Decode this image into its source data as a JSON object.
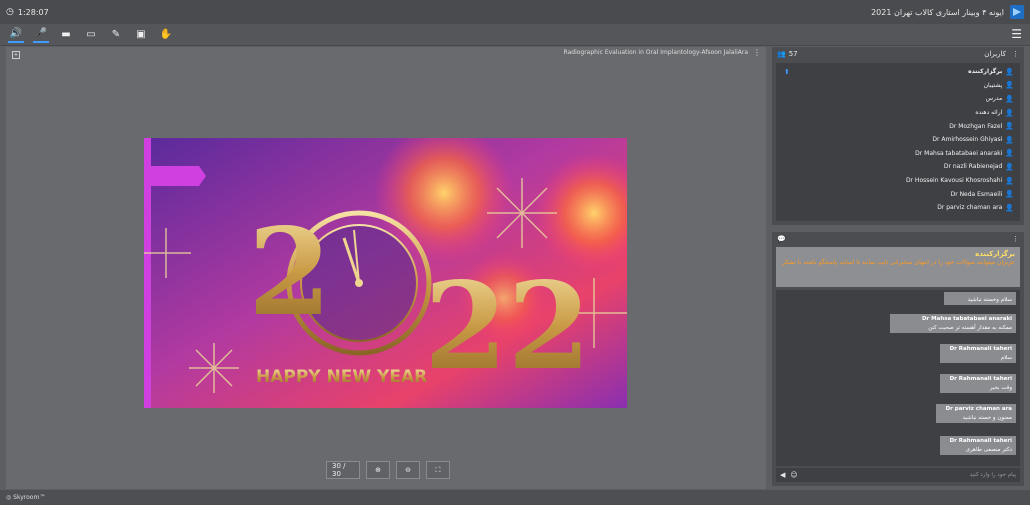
{
  "topbar": {
    "timer": "1:28:07",
    "title": "ایونه ۴ وبینار استاری کالاب تهران 2021"
  },
  "stage": {
    "title": "Radiographic Evaluation in Oral Implantology-Afsoon JalaliAra",
    "slide_text": "HAPPY NEW YEAR",
    "slide_digit_2": "2",
    "slide_digits_22": "22",
    "page_indicator": "30 / 30"
  },
  "status": {
    "brand": "Skyroom™"
  },
  "users": {
    "count": "57",
    "title": "کاربران",
    "items": [
      {
        "name": "برگزارکننده",
        "presenter": true
      },
      {
        "name": "پشتیبان"
      },
      {
        "name": "مدرس"
      },
      {
        "name": "ارائه دهنده"
      },
      {
        "name": "Dr Mozhgan Fazel"
      },
      {
        "name": "Dr Amirhossein Ghiyasi"
      },
      {
        "name": "Dr Mahsa tabatabaei anaraki"
      },
      {
        "name": "Dr nazli Rabienejad"
      },
      {
        "name": "Dr Hossein Kavousi Khosroshahi"
      },
      {
        "name": "Dr Neda Esmaeili"
      },
      {
        "name": "Dr parviz chaman ara"
      }
    ]
  },
  "chat": {
    "notice_title": "برگزارکننده",
    "notice_body": "عزیزان میتوانند سوالات خود را در انتهای سخنرانی تایپ نمایند تا اساتید پاسخگو باشند با تشکر",
    "messages": [
      {
        "sender": "",
        "text": "سلام وخسته نباشید"
      },
      {
        "sender": "Dr Mahsa tabatabaei anaraki",
        "text": "ممکنه به مقدار آهسته تر صحبت کنن"
      },
      {
        "sender": "Dr Rahmanali taheri",
        "text": "سلام"
      },
      {
        "sender": "Dr Rahmanali taheri",
        "text": "وقت بخیر"
      },
      {
        "sender": "Dr parviz chaman ara",
        "text": "ممنون و خسته نباشید"
      },
      {
        "sender": "Dr Rahmanali taheri",
        "text": "دکتر منصفی طاهری"
      }
    ],
    "input_placeholder": "پیام خود را وارد کنید"
  },
  "colors": {
    "accent": "#3e9bff",
    "notice_title": "#ffe066",
    "notice_body": "#ff9a1f"
  }
}
